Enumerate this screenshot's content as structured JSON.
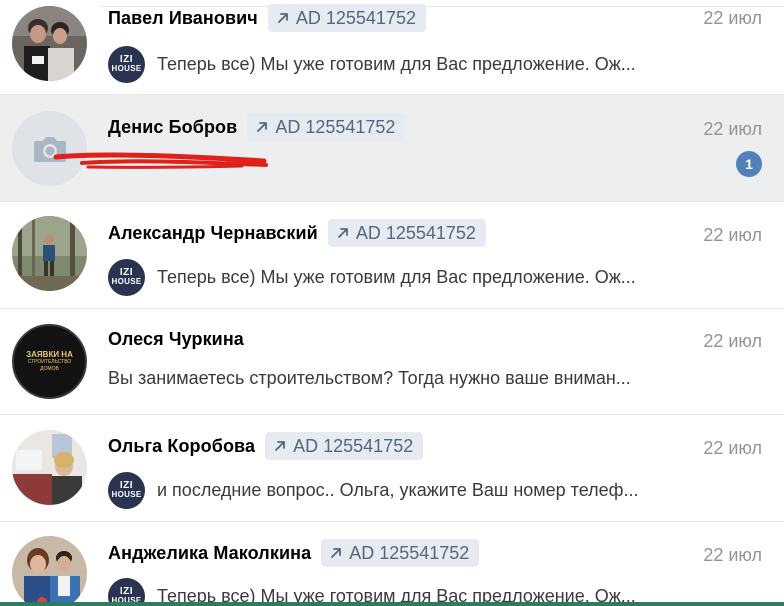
{
  "conversations": [
    {
      "name": "Павел Иванович",
      "badge": "AD 125541752",
      "date": "22 июл",
      "sender_avatar": [
        "IZI",
        "HOUSE"
      ],
      "message": "Теперь все) Мы уже готовим для Вас предложение. Ож..."
    },
    {
      "name": "Денис Бобров",
      "badge": "AD 125541752",
      "date": "22 июл",
      "unread_count": "1"
    },
    {
      "name": "Александр Чернавский",
      "badge": "AD 125541752",
      "date": "22 июл",
      "sender_avatar": [
        "IZI",
        "HOUSE"
      ],
      "message": "Теперь все) Мы уже готовим для Вас предложение. Ож..."
    },
    {
      "name": "Олеся Чуркина",
      "date": "22 июл",
      "avatar_text": [
        "ЗАЯВКИ НА",
        "СТРОИТЕЛЬСТВО",
        "ДОМОВ"
      ],
      "message": "Вы занимаетесь строительством? Тогда нужно ваше вниман..."
    },
    {
      "name": "Ольга Коробова",
      "badge": "AD 125541752",
      "date": "22 июл",
      "sender_avatar": [
        "IZI",
        "HOUSE"
      ],
      "message": "и последние вопрос.. Ольга, укажите Ваш номер телеф..."
    },
    {
      "name": "Анджелика Маколкина",
      "badge": "AD 125541752",
      "date": "22 июл",
      "sender_avatar": [
        "IZI",
        "HOUSE"
      ],
      "message": "Теперь все) Мы уже готовим для Вас предложение. Ож..."
    }
  ],
  "colors": {
    "unread_bg": "#edeef0",
    "badge_bg": "#e5ebf1",
    "badge_text": "#55677d",
    "unread_badge": "#5181b8",
    "redaction": "#e0201b"
  },
  "icons": {
    "badge": "arrow-up-right-icon",
    "placeholder_avatar": "camera-icon"
  }
}
